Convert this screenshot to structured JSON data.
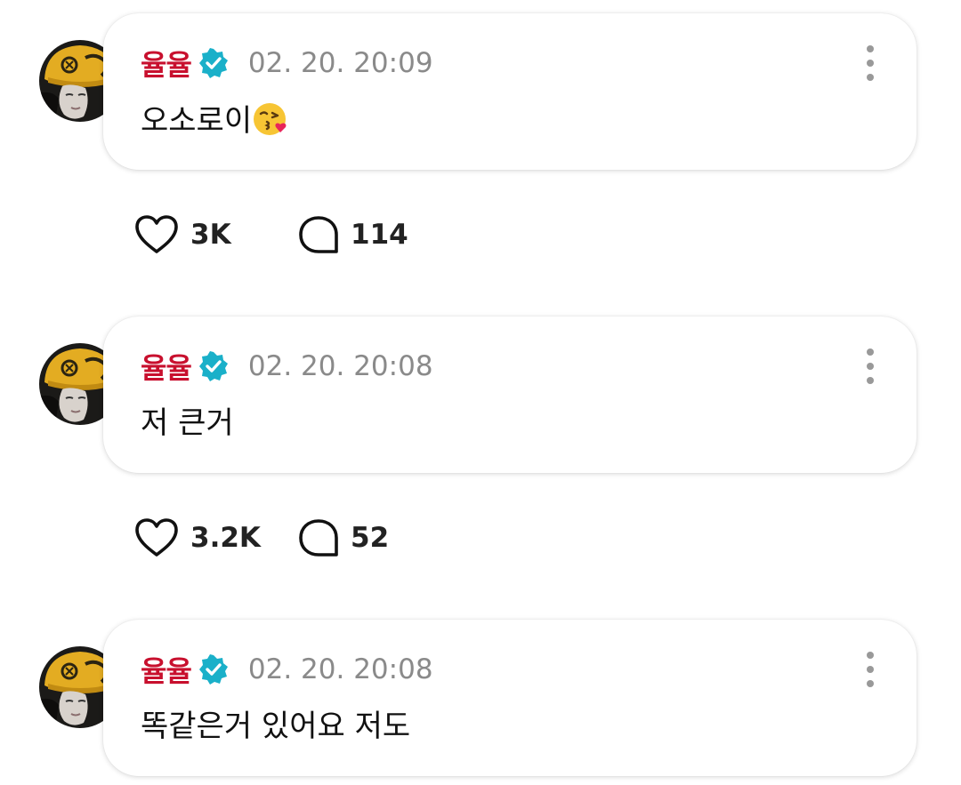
{
  "colors": {
    "author": "#c8102e",
    "verified_badge": "#1ab0c9",
    "timestamp": "#8a8a8a",
    "text": "#111111"
  },
  "icons": {
    "verified": "verified-badge-icon",
    "more": "more-vertical-icon",
    "like": "heart-icon",
    "comment": "speech-bubble-icon"
  },
  "posts": [
    {
      "author": "율율",
      "timestamp": "02. 20. 20:09",
      "text": "오소로이",
      "emoji": "face-blowing-kiss",
      "likes": "3K",
      "comments": "114"
    },
    {
      "author": "율율",
      "timestamp": "02. 20. 20:08",
      "text": "저 큰거",
      "likes": "3.2K",
      "comments": "52"
    },
    {
      "author": "율율",
      "timestamp": "02. 20. 20:08",
      "text": "똑같은거 있어요 저도"
    }
  ]
}
